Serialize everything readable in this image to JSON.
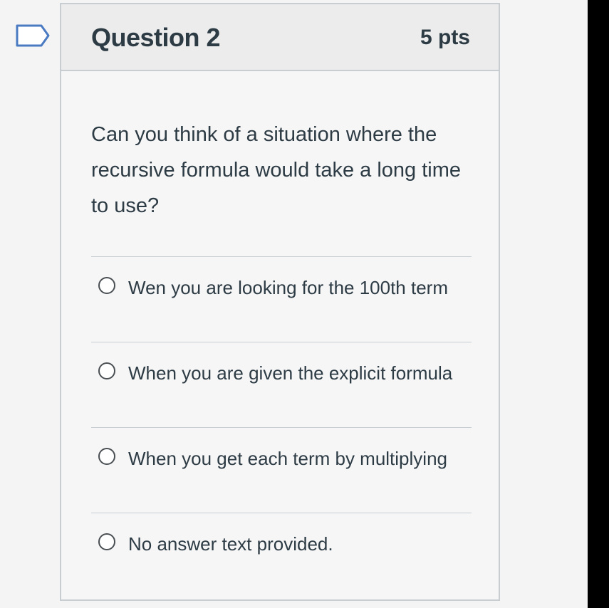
{
  "question": {
    "title": "Question 2",
    "points": "5 pts",
    "text": "Can you think of a situation where the recursive formula would take a long time to use?",
    "flag_icon": "bookmark-flag-icon"
  },
  "answers": [
    {
      "label": "Wen you are looking for the 100th term",
      "selected": false
    },
    {
      "label": "When you are given the explicit formula",
      "selected": false
    },
    {
      "label": "When you get each term by multiplying",
      "selected": false
    },
    {
      "label": "No answer text provided.",
      "selected": false
    }
  ],
  "colors": {
    "text": "#2d3b45",
    "border": "#c7cdd1",
    "header_bg": "#ececec",
    "card_bg": "#f6f6f6"
  }
}
